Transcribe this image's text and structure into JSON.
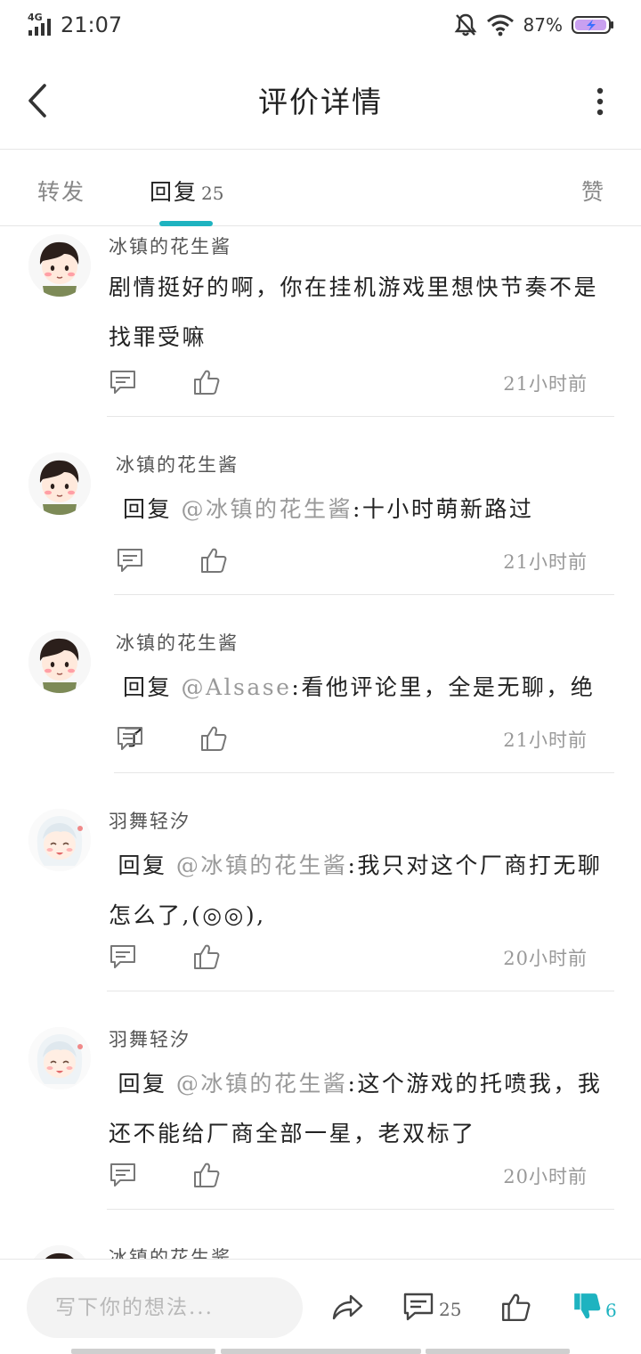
{
  "status_bar": {
    "network": "4G",
    "time": "21:07",
    "battery_percent": "87%"
  },
  "header": {
    "title": "评价详情"
  },
  "tabs": {
    "forward": "转发",
    "reply": "回复",
    "reply_count": "25",
    "like": "赞",
    "active": "reply",
    "accent_color": "#1eb3c0"
  },
  "comments": [
    {
      "author": "冰镇的花生酱",
      "avatar": "boy-avatar",
      "prefix": "",
      "mention": "",
      "text_line1": "剧情挺好的啊，你在挂机游戏里想快节奏不是",
      "text_line2": "找罪受嘛",
      "time": "21小时前"
    },
    {
      "author": "冰镇的花生酱",
      "avatar": "boy-avatar",
      "prefix": "回复",
      "mention": "@冰镇的花生酱",
      "text_line1": ":十小时萌新路过",
      "text_line2": "",
      "time": "21小时前"
    },
    {
      "author": "冰镇的花生酱",
      "avatar": "boy-avatar",
      "prefix": "回复",
      "mention": "@Alsase",
      "text_line1": ":看他评论里，全是无聊，绝了",
      "text_line2": "",
      "time": "21小时前"
    },
    {
      "author": "羽舞轻汐",
      "avatar": "girl-avatar",
      "prefix": "回复",
      "mention": "@冰镇的花生酱",
      "text_line1": ":我只对这个厂商打无聊",
      "text_line2": "怎么了,(◎◎),",
      "time": "20小时前"
    },
    {
      "author": "羽舞轻汐",
      "avatar": "girl-avatar",
      "prefix": "回复",
      "mention": "@冰镇的花生酱",
      "text_line1": ":这个游戏的托喷我，我",
      "text_line2": "还不能给厂商全部一星，老双标了",
      "time": "20小时前"
    },
    {
      "author": "冰镇的花生酱",
      "avatar": "boy-avatar",
      "prefix": "",
      "mention": "",
      "text_line1": "",
      "text_line2": "",
      "time": ""
    }
  ],
  "bottom_bar": {
    "placeholder": "写下你的想法...",
    "comment_count": "25",
    "dislike_count": "6"
  }
}
